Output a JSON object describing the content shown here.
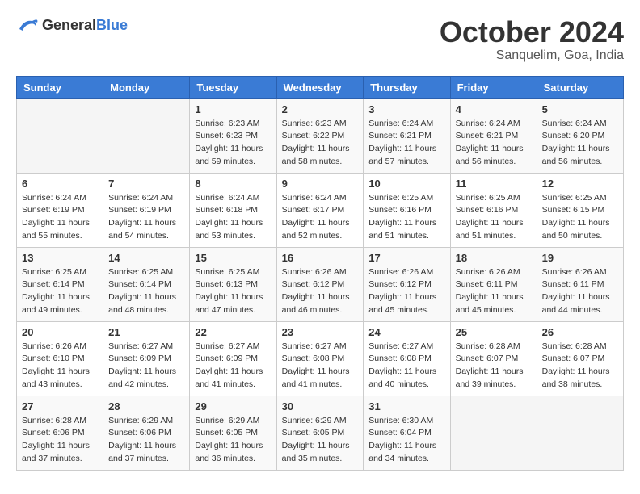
{
  "header": {
    "logo_general": "General",
    "logo_blue": "Blue",
    "month": "October 2024",
    "location": "Sanquelim, Goa, India"
  },
  "columns": [
    "Sunday",
    "Monday",
    "Tuesday",
    "Wednesday",
    "Thursday",
    "Friday",
    "Saturday"
  ],
  "weeks": [
    [
      {
        "day": "",
        "sunrise": "",
        "sunset": "",
        "daylight": ""
      },
      {
        "day": "",
        "sunrise": "",
        "sunset": "",
        "daylight": ""
      },
      {
        "day": "1",
        "sunrise": "Sunrise: 6:23 AM",
        "sunset": "Sunset: 6:23 PM",
        "daylight": "Daylight: 11 hours and 59 minutes."
      },
      {
        "day": "2",
        "sunrise": "Sunrise: 6:23 AM",
        "sunset": "Sunset: 6:22 PM",
        "daylight": "Daylight: 11 hours and 58 minutes."
      },
      {
        "day": "3",
        "sunrise": "Sunrise: 6:24 AM",
        "sunset": "Sunset: 6:21 PM",
        "daylight": "Daylight: 11 hours and 57 minutes."
      },
      {
        "day": "4",
        "sunrise": "Sunrise: 6:24 AM",
        "sunset": "Sunset: 6:21 PM",
        "daylight": "Daylight: 11 hours and 56 minutes."
      },
      {
        "day": "5",
        "sunrise": "Sunrise: 6:24 AM",
        "sunset": "Sunset: 6:20 PM",
        "daylight": "Daylight: 11 hours and 56 minutes."
      }
    ],
    [
      {
        "day": "6",
        "sunrise": "Sunrise: 6:24 AM",
        "sunset": "Sunset: 6:19 PM",
        "daylight": "Daylight: 11 hours and 55 minutes."
      },
      {
        "day": "7",
        "sunrise": "Sunrise: 6:24 AM",
        "sunset": "Sunset: 6:19 PM",
        "daylight": "Daylight: 11 hours and 54 minutes."
      },
      {
        "day": "8",
        "sunrise": "Sunrise: 6:24 AM",
        "sunset": "Sunset: 6:18 PM",
        "daylight": "Daylight: 11 hours and 53 minutes."
      },
      {
        "day": "9",
        "sunrise": "Sunrise: 6:24 AM",
        "sunset": "Sunset: 6:17 PM",
        "daylight": "Daylight: 11 hours and 52 minutes."
      },
      {
        "day": "10",
        "sunrise": "Sunrise: 6:25 AM",
        "sunset": "Sunset: 6:16 PM",
        "daylight": "Daylight: 11 hours and 51 minutes."
      },
      {
        "day": "11",
        "sunrise": "Sunrise: 6:25 AM",
        "sunset": "Sunset: 6:16 PM",
        "daylight": "Daylight: 11 hours and 51 minutes."
      },
      {
        "day": "12",
        "sunrise": "Sunrise: 6:25 AM",
        "sunset": "Sunset: 6:15 PM",
        "daylight": "Daylight: 11 hours and 50 minutes."
      }
    ],
    [
      {
        "day": "13",
        "sunrise": "Sunrise: 6:25 AM",
        "sunset": "Sunset: 6:14 PM",
        "daylight": "Daylight: 11 hours and 49 minutes."
      },
      {
        "day": "14",
        "sunrise": "Sunrise: 6:25 AM",
        "sunset": "Sunset: 6:14 PM",
        "daylight": "Daylight: 11 hours and 48 minutes."
      },
      {
        "day": "15",
        "sunrise": "Sunrise: 6:25 AM",
        "sunset": "Sunset: 6:13 PM",
        "daylight": "Daylight: 11 hours and 47 minutes."
      },
      {
        "day": "16",
        "sunrise": "Sunrise: 6:26 AM",
        "sunset": "Sunset: 6:12 PM",
        "daylight": "Daylight: 11 hours and 46 minutes."
      },
      {
        "day": "17",
        "sunrise": "Sunrise: 6:26 AM",
        "sunset": "Sunset: 6:12 PM",
        "daylight": "Daylight: 11 hours and 45 minutes."
      },
      {
        "day": "18",
        "sunrise": "Sunrise: 6:26 AM",
        "sunset": "Sunset: 6:11 PM",
        "daylight": "Daylight: 11 hours and 45 minutes."
      },
      {
        "day": "19",
        "sunrise": "Sunrise: 6:26 AM",
        "sunset": "Sunset: 6:11 PM",
        "daylight": "Daylight: 11 hours and 44 minutes."
      }
    ],
    [
      {
        "day": "20",
        "sunrise": "Sunrise: 6:26 AM",
        "sunset": "Sunset: 6:10 PM",
        "daylight": "Daylight: 11 hours and 43 minutes."
      },
      {
        "day": "21",
        "sunrise": "Sunrise: 6:27 AM",
        "sunset": "Sunset: 6:09 PM",
        "daylight": "Daylight: 11 hours and 42 minutes."
      },
      {
        "day": "22",
        "sunrise": "Sunrise: 6:27 AM",
        "sunset": "Sunset: 6:09 PM",
        "daylight": "Daylight: 11 hours and 41 minutes."
      },
      {
        "day": "23",
        "sunrise": "Sunrise: 6:27 AM",
        "sunset": "Sunset: 6:08 PM",
        "daylight": "Daylight: 11 hours and 41 minutes."
      },
      {
        "day": "24",
        "sunrise": "Sunrise: 6:27 AM",
        "sunset": "Sunset: 6:08 PM",
        "daylight": "Daylight: 11 hours and 40 minutes."
      },
      {
        "day": "25",
        "sunrise": "Sunrise: 6:28 AM",
        "sunset": "Sunset: 6:07 PM",
        "daylight": "Daylight: 11 hours and 39 minutes."
      },
      {
        "day": "26",
        "sunrise": "Sunrise: 6:28 AM",
        "sunset": "Sunset: 6:07 PM",
        "daylight": "Daylight: 11 hours and 38 minutes."
      }
    ],
    [
      {
        "day": "27",
        "sunrise": "Sunrise: 6:28 AM",
        "sunset": "Sunset: 6:06 PM",
        "daylight": "Daylight: 11 hours and 37 minutes."
      },
      {
        "day": "28",
        "sunrise": "Sunrise: 6:29 AM",
        "sunset": "Sunset: 6:06 PM",
        "daylight": "Daylight: 11 hours and 37 minutes."
      },
      {
        "day": "29",
        "sunrise": "Sunrise: 6:29 AM",
        "sunset": "Sunset: 6:05 PM",
        "daylight": "Daylight: 11 hours and 36 minutes."
      },
      {
        "day": "30",
        "sunrise": "Sunrise: 6:29 AM",
        "sunset": "Sunset: 6:05 PM",
        "daylight": "Daylight: 11 hours and 35 minutes."
      },
      {
        "day": "31",
        "sunrise": "Sunrise: 6:30 AM",
        "sunset": "Sunset: 6:04 PM",
        "daylight": "Daylight: 11 hours and 34 minutes."
      },
      {
        "day": "",
        "sunrise": "",
        "sunset": "",
        "daylight": ""
      },
      {
        "day": "",
        "sunrise": "",
        "sunset": "",
        "daylight": ""
      }
    ]
  ]
}
